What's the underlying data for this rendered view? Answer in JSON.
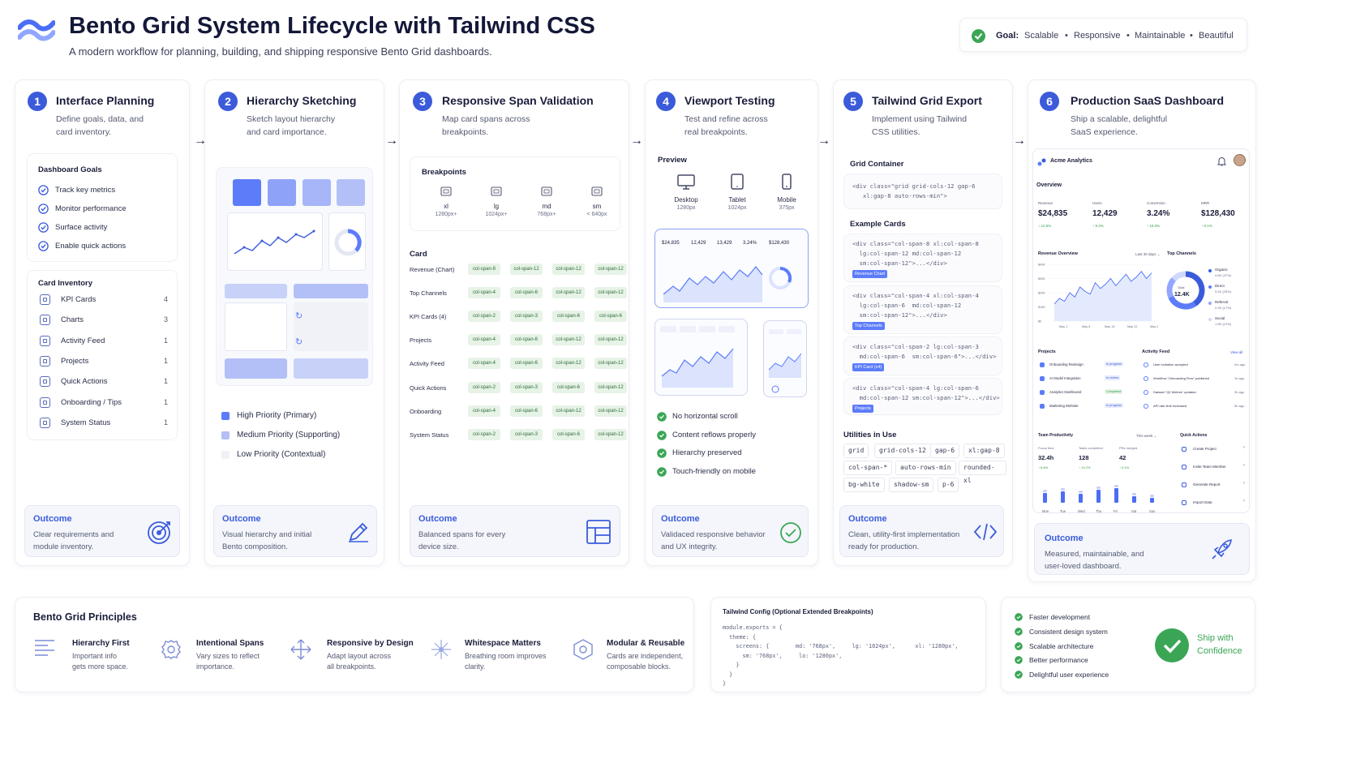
{
  "header": {
    "title": "Bento Grid System Lifecycle with Tailwind CSS",
    "subtitle": "A modern workflow for planning, building, and shipping responsive Bento Grid dashboards.",
    "goal_label": "Goal:",
    "goals": [
      "Scalable",
      "Responsive",
      "Maintainable",
      "Beautiful"
    ],
    "sep": "•"
  },
  "stages": [
    {
      "num": "1",
      "title": "Interface Planning",
      "desc": [
        "Define goals, data, and",
        "card inventory."
      ],
      "outcome_title": "Outcome",
      "outcome_desc": [
        "Clear requirements and",
        "module inventory."
      ]
    },
    {
      "num": "2",
      "title": "Hierarchy Sketching",
      "desc": [
        "Sketch layout hierarchy",
        "and card importance."
      ],
      "outcome_title": "Outcome",
      "outcome_desc": [
        "Visual hierarchy and initial",
        "Bento composition."
      ]
    },
    {
      "num": "3",
      "title": "Responsive Span Validation",
      "desc": [
        "Map card spans across",
        "breakpoints."
      ],
      "outcome_title": "Outcome",
      "outcome_desc": [
        "Balanced spans for every",
        "device size."
      ]
    },
    {
      "num": "4",
      "title": "Viewport Testing",
      "desc": [
        "Test and refine across",
        "real breakpoints."
      ],
      "outcome_title": "Outcome",
      "outcome_desc": [
        "Validaced responsive behavior",
        "and UX integrity."
      ]
    },
    {
      "num": "5",
      "title": "Tailwind Grid Export",
      "desc": [
        "Implement using Tailwind",
        "CSS utilities."
      ],
      "outcome_title": "Outcome",
      "outcome_desc": [
        "Clean, utility-first implementation",
        "ready for production."
      ]
    },
    {
      "num": "6",
      "title": "Production SaaS Dashboard",
      "desc": [
        "Ship a scalable, delightful",
        "SaaS experience."
      ],
      "outcome_title": "Outcome",
      "outcome_desc": [
        "Measured, maintainable, and",
        "user-loved dashboard."
      ]
    }
  ],
  "arrow": "→",
  "planning": {
    "goals_title": "Dashboard Goals",
    "goals": [
      "Track key metrics",
      "Monitor performance",
      "Surface activity",
      "Enable quick actions"
    ],
    "inventory_title": "Card Inventory",
    "inventory": [
      {
        "name": "KPI Cards",
        "count": "4"
      },
      {
        "name": "Charts",
        "count": "3"
      },
      {
        "name": "Activity Feed",
        "count": "1"
      },
      {
        "name": "Projects",
        "count": "1"
      },
      {
        "name": "Quick Actions",
        "count": "1"
      },
      {
        "name": "Onboarding / Tips",
        "count": "1"
      },
      {
        "name": "System Status",
        "count": "1"
      }
    ]
  },
  "sketch": {
    "legend": [
      {
        "label": "High Priority (Primary)",
        "color": "#5c7cfa"
      },
      {
        "label": "Medium Priority (Supporting)",
        "color": "#b3c0f7"
      },
      {
        "label": "Low Priority (Contextual)",
        "color": "#f0f1f5"
      }
    ]
  },
  "spans": {
    "breakpoints_title": "Breakpoints",
    "breakpoints": [
      {
        "name": "xl",
        "size": "1280px+"
      },
      {
        "name": "lg",
        "size": "1024px+"
      },
      {
        "name": "md",
        "size": "768px+"
      },
      {
        "name": "sm",
        "size": "< 640px"
      }
    ],
    "card_header": "Card",
    "rows": [
      {
        "name": "Revenue (Chart)",
        "spans": [
          "col-span-8",
          "col-span-12",
          "col-span-12",
          "col-span-12"
        ]
      },
      {
        "name": "Top Channels",
        "spans": [
          "col-span-4",
          "col-span-6",
          "col-span-12",
          "col-span-12"
        ]
      },
      {
        "name": "KPI Cards (4)",
        "spans": [
          "col-span-2",
          "col-span-3",
          "col-span-6",
          "col-span-6"
        ]
      },
      {
        "name": "Projects",
        "spans": [
          "col-span-4",
          "col-span-6",
          "col-span-12",
          "col-span-12"
        ]
      },
      {
        "name": "Activity Feed",
        "spans": [
          "col-span-4",
          "col-span-6",
          "col-span-12",
          "col-span-12"
        ]
      },
      {
        "name": "Quick Actions",
        "spans": [
          "col-span-2",
          "col-span-3",
          "col-span-6",
          "col-span-12"
        ]
      },
      {
        "name": "Onboarding",
        "spans": [
          "col-span-4",
          "col-span-6",
          "col-span-12",
          "col-span-12"
        ]
      },
      {
        "name": "System Status",
        "spans": [
          "col-span-2",
          "col-span-3",
          "col-span-6",
          "col-span-12"
        ]
      }
    ]
  },
  "viewport": {
    "preview_title": "Preview",
    "devices": [
      {
        "name": "Desktop",
        "size": "1280px"
      },
      {
        "name": "Tablet",
        "size": "1024px"
      },
      {
        "name": "Mobile",
        "size": "375px"
      }
    ],
    "checks": [
      "No horizontal scroll",
      "Content reflows properly",
      "Hierarchy preserved",
      "Touch-friendly on mobile"
    ],
    "mini_kpis": [
      "$24,835",
      "12,429",
      "13,429",
      "3.24%",
      "$128,430"
    ]
  },
  "export": {
    "grid_container_title": "Grid Container",
    "grid_container_code": "<div class=\"grid grid-cols-12 gap-6\n   xl:gap-8 auto-rows-min\">",
    "example_title": "Example Cards",
    "examples": [
      {
        "code": "<div class=\"col-span-8 xl:col-span-8\n  lg:col-span-12 md:col-span-12\n  sm:col-span-12\">...</div>",
        "tag": "Revenue Chart"
      },
      {
        "code": "<div class=\"col-span-4 xl:col-span-4\n  lg:col-span-6  md:col-span-12\n  sm:col-span-12\">...</div>",
        "tag": "Top Channels"
      },
      {
        "code": "<div class=\"col-span-2 lg:col-span-3\n  md:col-span-6  sm:col-span-6\">...</div>",
        "tag": "KPI Card (x4)"
      },
      {
        "code": "<div class=\"col-span-4 lg:col-span-6\n  md:col-span-12 sm:col-span-12\">...</div>",
        "tag": "Projects"
      }
    ],
    "utilities_title": "Utilities in Use",
    "utilities": [
      [
        "grid",
        "grid-cols-12",
        "gap-6",
        "xl:gap-8"
      ],
      [
        "col-span-*",
        "auto-rows-min",
        "rounded-xl"
      ],
      [
        "bg-white",
        "shadow-sm",
        "p-6"
      ]
    ]
  },
  "dashboard": {
    "brand": "Acme Analytics",
    "overview": "Overview",
    "kpis": [
      {
        "label": "Revenue",
        "value": "$24,835",
        "delta": "↑ 12.5%"
      },
      {
        "label": "Users",
        "value": "12,429",
        "delta": "↑ 8.2%"
      },
      {
        "label": "Conversion",
        "value": "3.24%",
        "delta": "↑ 16.3%"
      },
      {
        "label": "MRR",
        "value": "$128,430",
        "delta": "↑ 9.1%"
      }
    ],
    "revenue_title": "Revenue Overview",
    "revenue_range": "Last 30 days ⌄",
    "revenue_y": [
      "$40K",
      "$30K",
      "$20K",
      "$10K",
      "$0"
    ],
    "revenue_x": [
      "May 1",
      "May 8",
      "May 15",
      "May 22",
      "May 29"
    ],
    "revenue_values": [
      12,
      16,
      14,
      20,
      17,
      24,
      21,
      19,
      27,
      23,
      26,
      30,
      25,
      29,
      33,
      28,
      31,
      35,
      30,
      34
    ],
    "channels_title": "Top Channels",
    "donut_label": "Total",
    "donut_value": "12.4K",
    "channels": [
      {
        "name": "Organic",
        "v": "4.6K (37%)",
        "color": "#3b5bdb",
        "pct": 37
      },
      {
        "name": "Direct",
        "v": "3.1K (25%)",
        "color": "#5c7cfa",
        "pct": 25
      },
      {
        "name": "Referral",
        "v": "2.2K (17%)",
        "color": "#91a7ff",
        "pct": 17
      },
      {
        "name": "Social",
        "v": "1.5K (12%)",
        "color": "#d0d8fb",
        "pct": 12
      }
    ],
    "projects_title": "Projects",
    "projects": [
      {
        "name": "Onboarding Redesign",
        "status": "In progress"
      },
      {
        "name": "AI Model Integration",
        "status": "In review"
      },
      {
        "name": "Analytics Dashboard",
        "status": "Completed"
      },
      {
        "name": "Marketing Website",
        "status": "In progress"
      }
    ],
    "activity_title": "Activity Feed",
    "activity_viewall": "View all",
    "activity": [
      {
        "text": "User invitation accepted",
        "time": "2m ago"
      },
      {
        "text": "Workflow \"Onboarding Flow\" published",
        "time": "1h ago"
      },
      {
        "text": "Dataset \"Q2 Metrics\" updated",
        "time": "3h ago"
      },
      {
        "text": "API rate limit increased",
        "time": "5h ago"
      }
    ],
    "team_title": "Team Productivity",
    "team_range": "This week ⌄",
    "team_stats": [
      {
        "label": "Focus time",
        "value": "32.4h",
        "delta": "↑ 8.6%"
      },
      {
        "label": "Tasks completed",
        "value": "128",
        "delta": "↑ 14.2%"
      },
      {
        "label": "PRs merged",
        "value": "42",
        "delta": "↑ 5.1%"
      }
    ],
    "team_days": [
      "Mon",
      "Tue",
      "Wed",
      "Thu",
      "Fri",
      "Sat",
      "Sun"
    ],
    "team_values": [
      0.6,
      0.7,
      0.55,
      0.8,
      0.9,
      0.4,
      0.3
    ],
    "quick_title": "Quick Actions",
    "quick": [
      "Create Project",
      "Invite Team Member",
      "Generate Report",
      "Import Data"
    ]
  },
  "principles": {
    "title": "Bento Grid Principles",
    "items": [
      {
        "title": "Hierarchy First",
        "desc": [
          "Important info",
          "gets more space."
        ]
      },
      {
        "title": "Intentional Spans",
        "desc": [
          "Vary sizes to reflect",
          "importance."
        ]
      },
      {
        "title": "Responsive by Design",
        "desc": [
          "Adapt layout across",
          "all breakpoints."
        ]
      },
      {
        "title": "Whitespace Matters",
        "desc": [
          "Breathing room improves",
          "clarity."
        ]
      },
      {
        "title": "Modular & Reusable",
        "desc": [
          "Cards are independent,",
          "composable blocks."
        ]
      }
    ]
  },
  "config": {
    "title": "Tailwind Config (Optional Extended Breakpoints)",
    "code": "module.exports = {\n  theme: {\n    screens: {        md: '768px',     lg: '1024px',      xl: '1280px',\n      sm: '768px',     lo: '1280px',\n    }\n  }\n}"
  },
  "benefits": {
    "items": [
      "Faster development",
      "Consistent design system",
      "Scalable architecture",
      "Better performance",
      "Delightful user experience"
    ],
    "ship": [
      "Ship with",
      "Confidence"
    ]
  },
  "colors": {
    "accent": "#3b5bdb",
    "success": "#3aa655"
  }
}
